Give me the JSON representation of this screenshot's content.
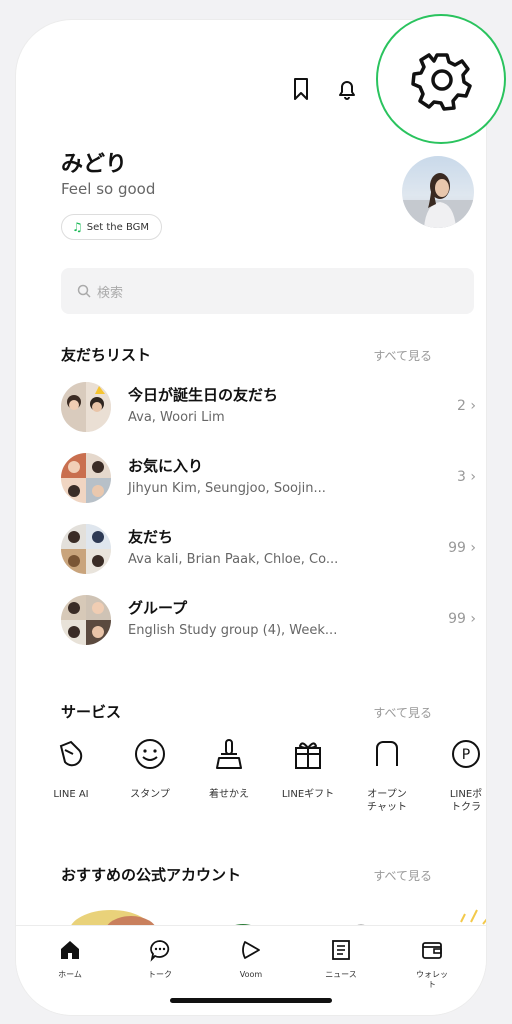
{
  "header": {
    "bookmark_icon": "bookmark-icon",
    "bell_icon": "bell-icon",
    "settings_icon": "gear-icon",
    "highlight_color": "#2ac35e"
  },
  "profile": {
    "name": "みどり",
    "status_message": "Feel so good",
    "bgm_label": "Set the BGM"
  },
  "search": {
    "placeholder": "検索"
  },
  "friends": {
    "title": "友だちリスト",
    "see_all": "すべて見る",
    "rows": [
      {
        "title": "今日が誕生日の友だち",
        "subtitle": "Ava, Woori Lim",
        "count": "2"
      },
      {
        "title": "お気に入り",
        "subtitle": "Jihyun Kim, Seungjoo, Soojin...",
        "count": "3"
      },
      {
        "title": "友だち",
        "subtitle": "Ava kali, Brian Paak, Chloe, Co...",
        "count": "99"
      },
      {
        "title": "グループ",
        "subtitle": "English Study group (4), Week...",
        "count": "99"
      }
    ]
  },
  "services": {
    "title": "サービス",
    "see_all": "すべて見る",
    "items": [
      {
        "label": "LINE AI",
        "icon": "line-ai-icon"
      },
      {
        "label": "スタンプ",
        "icon": "smiley-icon"
      },
      {
        "label": "着せかえ",
        "icon": "brush-icon"
      },
      {
        "label": "LINEギフト",
        "icon": "gift-icon"
      },
      {
        "label": "オープン\nチャット",
        "icon": "openchat-icon"
      },
      {
        "label": "LINEポ\nトクラ",
        "icon": "points-icon"
      }
    ]
  },
  "official": {
    "title": "おすすめの公式アカウント",
    "see_all": "すべて見る"
  },
  "tabs": [
    {
      "label": "ホーム",
      "icon": "home-icon",
      "active": true
    },
    {
      "label": "トーク",
      "icon": "chat-icon"
    },
    {
      "label": "Voom",
      "icon": "voom-icon"
    },
    {
      "label": "ニュース",
      "icon": "news-icon"
    },
    {
      "label": "ウォレッ\nト",
      "icon": "wallet-icon"
    }
  ]
}
